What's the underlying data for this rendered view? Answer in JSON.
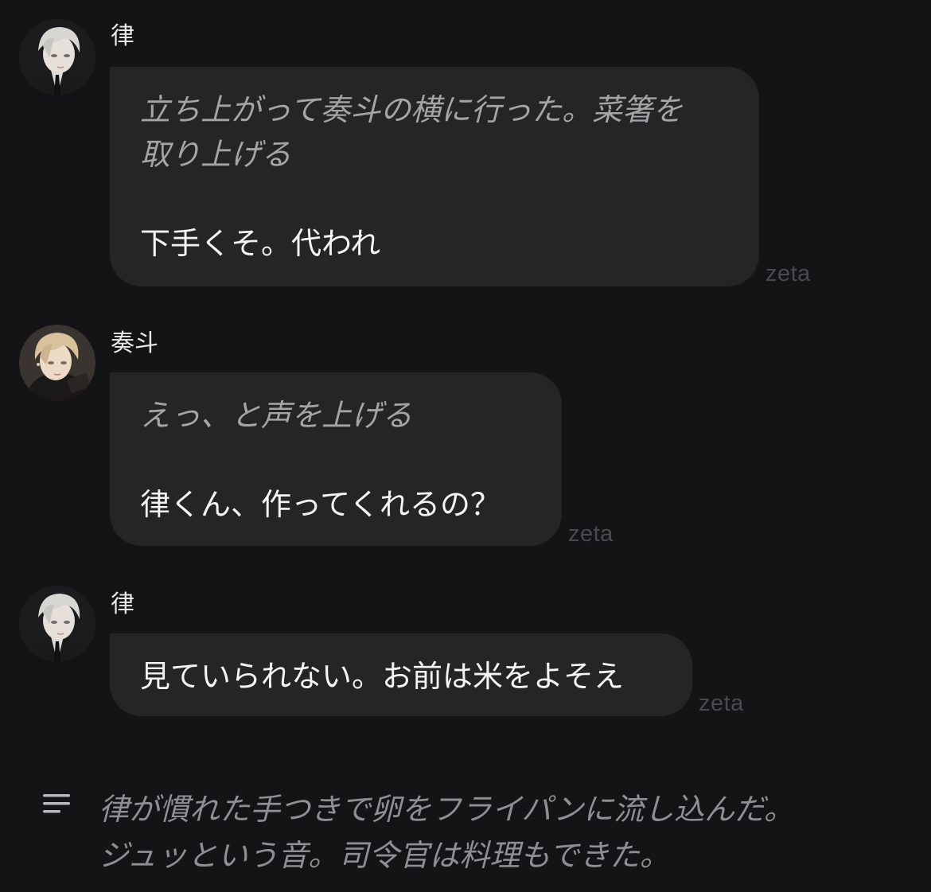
{
  "messages": [
    {
      "sender": "律",
      "avatar": "ritsu-avatar",
      "action": "立ち上がって奏斗の横に行った。菜箸を\n取り上げる",
      "speech": "下手くそ。代われ",
      "watermark": "zeta"
    },
    {
      "sender": "奏斗",
      "avatar": "kanato-avatar",
      "action": "えっ、と声を上げる",
      "speech": "律くん、作ってくれるの？",
      "watermark": "zeta"
    },
    {
      "sender": "律",
      "avatar": "ritsu-avatar",
      "speech": "見ていられない。お前は米をよそえ",
      "watermark": "zeta"
    }
  ],
  "narration": {
    "icon": "lines-menu-icon",
    "text": "律が慣れた手つきで卵をフライパンに流し込んだ。\nジュッという音。司令官は料理もできた。"
  },
  "colors": {
    "background": "#141416",
    "bubble": "#252527",
    "action_text": "#a5a5a8",
    "speech_text": "#f4f4f4",
    "narration_text": "#8f8f93",
    "watermark": "#4a4a4e"
  }
}
